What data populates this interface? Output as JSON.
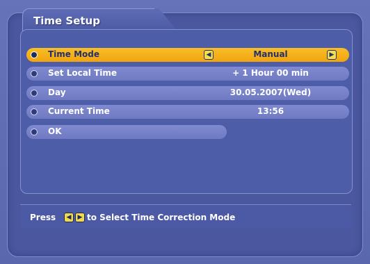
{
  "window": {
    "title": "Time Setup"
  },
  "menu": {
    "rows": [
      {
        "label": "Time Mode",
        "value": "Manual"
      },
      {
        "label": "Set Local Time",
        "value": "+ 1 Hour 00 min"
      },
      {
        "label": "Day",
        "value": "30.05.2007(Wed)"
      },
      {
        "label": "Current Time",
        "value": "13:56"
      },
      {
        "label": "OK",
        "value": ""
      }
    ]
  },
  "help": {
    "prefix": "Press",
    "text": "to Select Time Correction Mode"
  },
  "icons": {
    "left": "left-arrow-icon",
    "right": "right-arrow-icon",
    "bullet": "bullet-icon"
  },
  "colors": {
    "panel": "#4b589f",
    "row": "#7f8ad0",
    "selected": "#f1a40f",
    "help_key": "#f1da46"
  }
}
